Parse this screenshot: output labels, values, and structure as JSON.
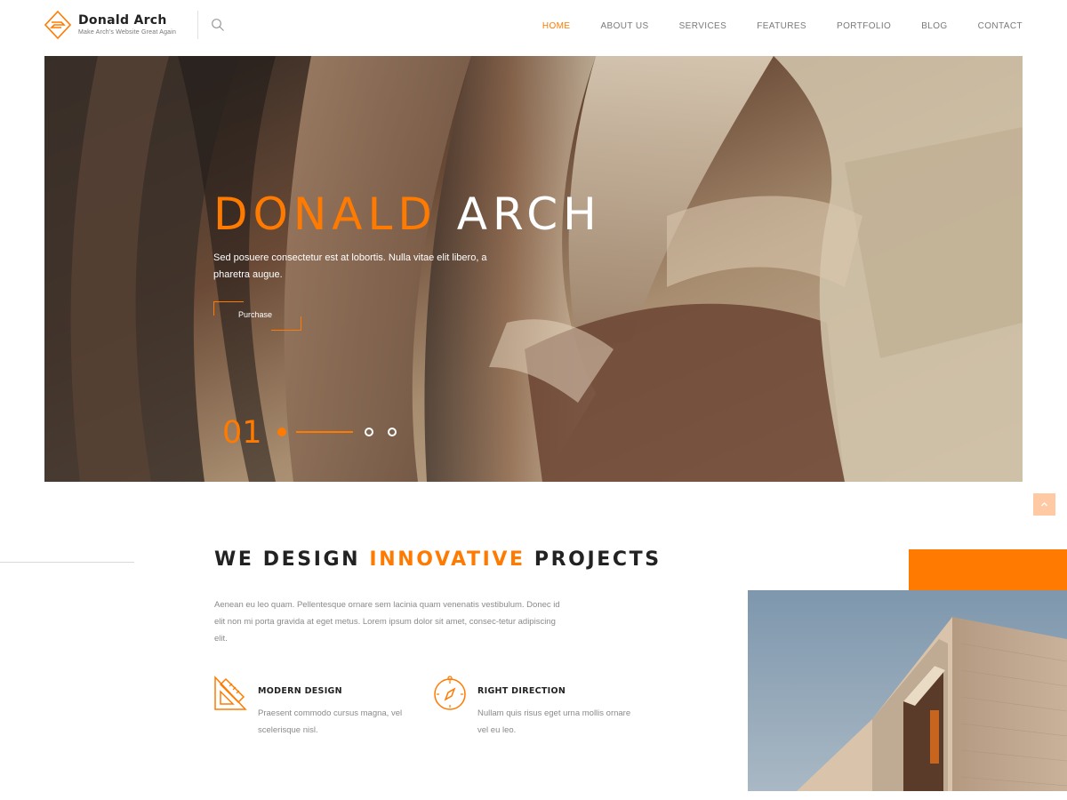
{
  "brand": {
    "name": "Donald Arch",
    "tagline": "Make Arch's Website Great Again",
    "accent_color": "#ff7a00"
  },
  "header": {
    "search_icon": "search-icon",
    "nav": [
      {
        "label": "HOME",
        "active": true
      },
      {
        "label": "ABOUT US",
        "active": false
      },
      {
        "label": "SERVICES",
        "active": false
      },
      {
        "label": "FEATURES",
        "active": false
      },
      {
        "label": "PORTFOLIO",
        "active": false
      },
      {
        "label": "BLOG",
        "active": false
      },
      {
        "label": "CONTACT",
        "active": false
      }
    ]
  },
  "hero": {
    "title_accent": "DONALD",
    "title_rest": "ARCH",
    "subtitle": "Sed posuere consectetur est at lobortis. Nulla vitae elit libero, a pharetra augue.",
    "button_label": "Purchase",
    "slide_number": "01",
    "slide_count": 3,
    "active_slide": 1
  },
  "scroll_top_icon": "chevron-up-icon",
  "intro": {
    "title_start": "WE DESIGN",
    "title_accent": "INNOVATIVE",
    "title_end": "PROJECTS",
    "description": "Aenean eu leo quam. Pellentesque ornare sem lacinia quam venenatis vestibulum. Donec id elit non mi porta gravida at eget metus. Lorem ipsum dolor sit amet, consec-tetur adipiscing elit.",
    "features": [
      {
        "icon": "ruler-triangle-icon",
        "title": "MODERN DESIGN",
        "text": "Praesent commodo cursus magna, vel scelerisque nisl."
      },
      {
        "icon": "compass-icon",
        "title": "RIGHT DIRECTION",
        "text": "Nullam quis risus eget urna mollis ornare vel eu leo."
      }
    ]
  }
}
